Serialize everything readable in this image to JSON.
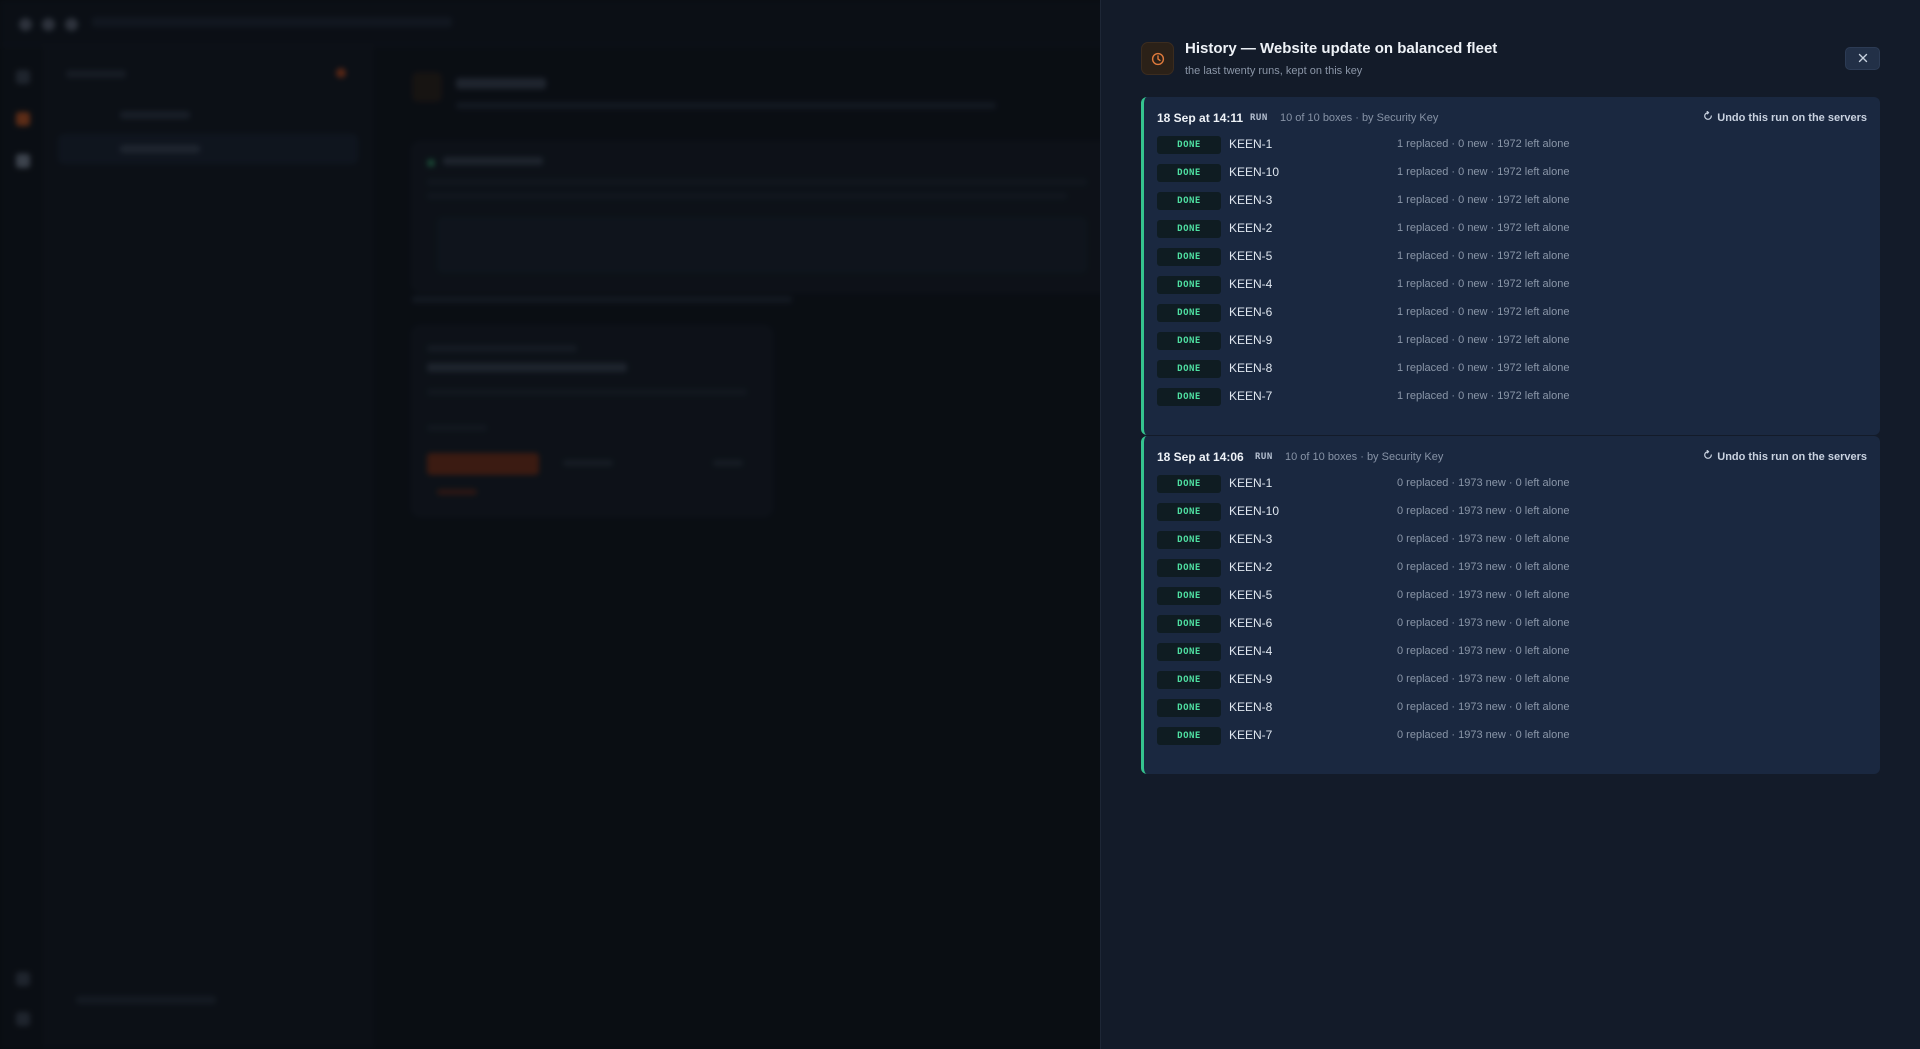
{
  "background": {
    "title": "",
    "items": [
      "",
      ""
    ],
    "footer": ""
  },
  "drawer": {
    "title": "History — Website update on balanced fleet",
    "subtitle": "the last twenty runs, kept on this key",
    "icon": "clock-icon",
    "close_icon": "close-icon",
    "accent_color": "#35c48f",
    "runs": [
      {
        "date": "18 Sep at 14:11",
        "tag": "RUN",
        "meta": "10 of 10 boxes · by Security Key",
        "undo_label": "Undo this run on the servers",
        "rows": [
          {
            "status": "DONE",
            "name": "KEEN-1",
            "stats": "1 replaced · 0 new · 1972 left alone"
          },
          {
            "status": "DONE",
            "name": "KEEN-10",
            "stats": "1 replaced · 0 new · 1972 left alone"
          },
          {
            "status": "DONE",
            "name": "KEEN-3",
            "stats": "1 replaced · 0 new · 1972 left alone"
          },
          {
            "status": "DONE",
            "name": "KEEN-2",
            "stats": "1 replaced · 0 new · 1972 left alone"
          },
          {
            "status": "DONE",
            "name": "KEEN-5",
            "stats": "1 replaced · 0 new · 1972 left alone"
          },
          {
            "status": "DONE",
            "name": "KEEN-4",
            "stats": "1 replaced · 0 new · 1972 left alone"
          },
          {
            "status": "DONE",
            "name": "KEEN-6",
            "stats": "1 replaced · 0 new · 1972 left alone"
          },
          {
            "status": "DONE",
            "name": "KEEN-9",
            "stats": "1 replaced · 0 new · 1972 left alone"
          },
          {
            "status": "DONE",
            "name": "KEEN-8",
            "stats": "1 replaced · 0 new · 1972 left alone"
          },
          {
            "status": "DONE",
            "name": "KEEN-7",
            "stats": "1 replaced · 0 new · 1972 left alone"
          }
        ]
      },
      {
        "date": "18 Sep at 14:06",
        "tag": "RUN",
        "meta": "10 of 10 boxes · by Security Key",
        "undo_label": "Undo this run on the servers",
        "rows": [
          {
            "status": "DONE",
            "name": "KEEN-1",
            "stats": "0 replaced · 1973 new · 0 left alone"
          },
          {
            "status": "DONE",
            "name": "KEEN-10",
            "stats": "0 replaced · 1973 new · 0 left alone"
          },
          {
            "status": "DONE",
            "name": "KEEN-3",
            "stats": "0 replaced · 1973 new · 0 left alone"
          },
          {
            "status": "DONE",
            "name": "KEEN-2",
            "stats": "0 replaced · 1973 new · 0 left alone"
          },
          {
            "status": "DONE",
            "name": "KEEN-5",
            "stats": "0 replaced · 1973 new · 0 left alone"
          },
          {
            "status": "DONE",
            "name": "KEEN-6",
            "stats": "0 replaced · 1973 new · 0 left alone"
          },
          {
            "status": "DONE",
            "name": "KEEN-4",
            "stats": "0 replaced · 1973 new · 0 left alone"
          },
          {
            "status": "DONE",
            "name": "KEEN-9",
            "stats": "0 replaced · 1973 new · 0 left alone"
          },
          {
            "status": "DONE",
            "name": "KEEN-8",
            "stats": "0 replaced · 1973 new · 0 left alone"
          },
          {
            "status": "DONE",
            "name": "KEEN-7",
            "stats": "0 replaced · 1973 new · 0 left alone"
          }
        ]
      }
    ]
  }
}
